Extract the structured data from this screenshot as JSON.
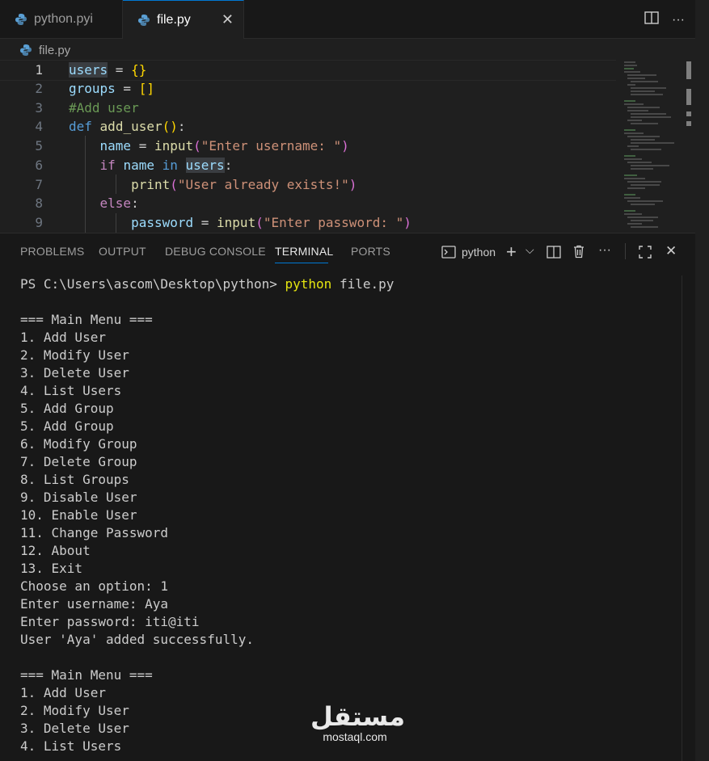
{
  "tabs": [
    {
      "label": "python.pyi",
      "active": false
    },
    {
      "label": "file.py",
      "active": true
    }
  ],
  "tab_close_glyph": "✕",
  "editor_actions": {
    "split": "split-editor-icon",
    "more": "···"
  },
  "breadcrumb": {
    "file": "file.py"
  },
  "editor": {
    "line_numbers": [
      "1",
      "2",
      "3",
      "4",
      "5",
      "6",
      "7",
      "8",
      "9"
    ],
    "lines": [
      "users = {}",
      "groups = []",
      "#Add user",
      "def add_user():",
      "    name = input(\"Enter username: \")",
      "    if name in users:",
      "        print(\"User already exists!\")",
      "    else:",
      "        password = input(\"Enter password: \")"
    ]
  },
  "panel": {
    "tabs": [
      "PROBLEMS",
      "OUTPUT",
      "DEBUG CONSOLE",
      "TERMINAL",
      "PORTS"
    ],
    "active_tab": "TERMINAL",
    "terminal_name": "python",
    "actions": {
      "add": "+",
      "dropdown": "⌵",
      "more": "···",
      "close": "✕"
    }
  },
  "terminal": {
    "prompt": "PS C:\\Users\\ascom\\Desktop\\python> ",
    "command_exe": "python",
    "command_args": " file.py",
    "output": [
      "",
      "=== Main Menu ===",
      "1. Add User",
      "2. Modify User",
      "3. Delete User",
      "4. List Users",
      "5. Add Group",
      "5. Add Group",
      "6. Modify Group",
      "7. Delete Group",
      "8. List Groups",
      "9. Disable User",
      "10. Enable User",
      "11. Change Password",
      "12. About",
      "13. Exit",
      "Choose an option: 1",
      "Enter username: Aya",
      "Enter password: iti@iti",
      "User 'Aya' added successfully.",
      "",
      "=== Main Menu ===",
      "1. Add User",
      "2. Modify User",
      "3. Delete User",
      "4. List Users"
    ]
  },
  "watermark": {
    "arabic": "مستقل",
    "latin": "mostaql.com"
  },
  "colors": {
    "accent": "#0078d4",
    "background": "#1f1f1f",
    "panel": "#181818"
  }
}
